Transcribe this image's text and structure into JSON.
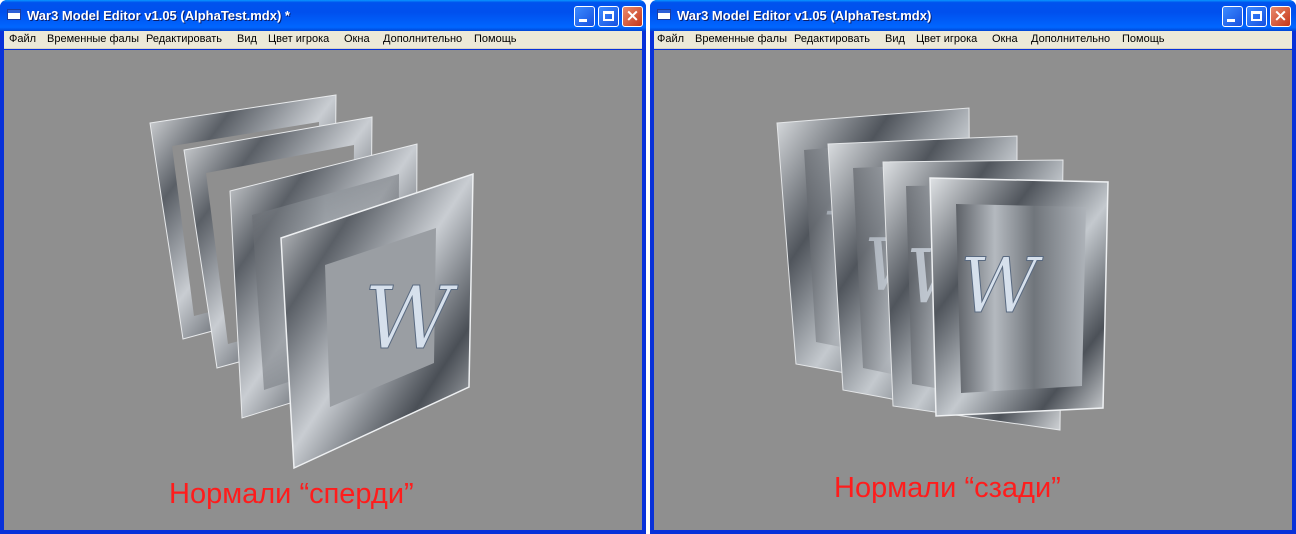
{
  "windows": [
    {
      "title": "War3 Model Editor v1.05 (AlphaTest.mdx) *",
      "menu": [
        "Файл",
        "Временные фалы",
        "Редактировать",
        "Вид",
        "Цвет игрока",
        "Окна",
        "Дополнительно",
        "Помощь"
      ],
      "caption": "Нормали “сперди”"
    },
    {
      "title": "War3 Model Editor v1.05 (AlphaTest.mdx)",
      "menu": [
        "Файл",
        "Временные фалы",
        "Редактировать",
        "Вид",
        "Цвет игрока",
        "Окна",
        "Дополнительно",
        "Помощь"
      ],
      "caption": "Нормали “сзади”"
    }
  ],
  "texture_letter": "W",
  "colors": {
    "viewport_bg": "#8f8f8f",
    "caption": "#ff1c1c",
    "titlebar": "#0055ea"
  }
}
